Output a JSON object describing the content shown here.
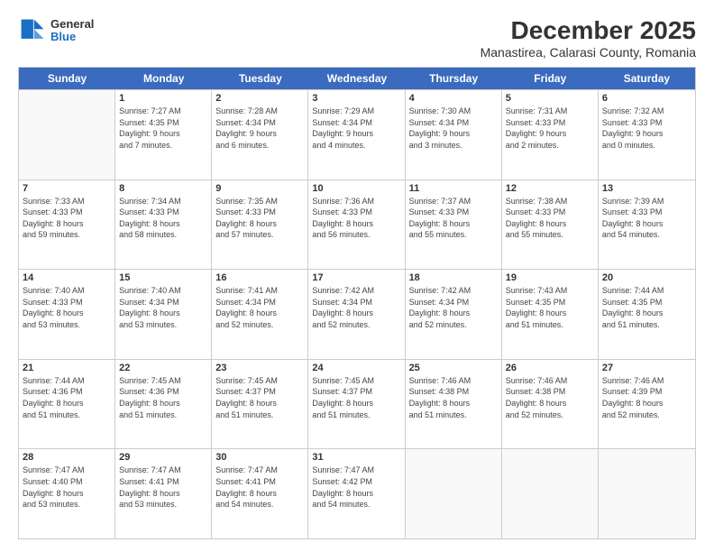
{
  "header": {
    "logo_general": "General",
    "logo_blue": "Blue",
    "title": "December 2025",
    "subtitle": "Manastirea, Calarasi County, Romania"
  },
  "calendar": {
    "days": [
      "Sunday",
      "Monday",
      "Tuesday",
      "Wednesday",
      "Thursday",
      "Friday",
      "Saturday"
    ],
    "rows": [
      [
        {
          "day": "",
          "content": ""
        },
        {
          "day": "1",
          "content": "Sunrise: 7:27 AM\nSunset: 4:35 PM\nDaylight: 9 hours\nand 7 minutes."
        },
        {
          "day": "2",
          "content": "Sunrise: 7:28 AM\nSunset: 4:34 PM\nDaylight: 9 hours\nand 6 minutes."
        },
        {
          "day": "3",
          "content": "Sunrise: 7:29 AM\nSunset: 4:34 PM\nDaylight: 9 hours\nand 4 minutes."
        },
        {
          "day": "4",
          "content": "Sunrise: 7:30 AM\nSunset: 4:34 PM\nDaylight: 9 hours\nand 3 minutes."
        },
        {
          "day": "5",
          "content": "Sunrise: 7:31 AM\nSunset: 4:33 PM\nDaylight: 9 hours\nand 2 minutes."
        },
        {
          "day": "6",
          "content": "Sunrise: 7:32 AM\nSunset: 4:33 PM\nDaylight: 9 hours\nand 0 minutes."
        }
      ],
      [
        {
          "day": "7",
          "content": "Sunrise: 7:33 AM\nSunset: 4:33 PM\nDaylight: 8 hours\nand 59 minutes."
        },
        {
          "day": "8",
          "content": "Sunrise: 7:34 AM\nSunset: 4:33 PM\nDaylight: 8 hours\nand 58 minutes."
        },
        {
          "day": "9",
          "content": "Sunrise: 7:35 AM\nSunset: 4:33 PM\nDaylight: 8 hours\nand 57 minutes."
        },
        {
          "day": "10",
          "content": "Sunrise: 7:36 AM\nSunset: 4:33 PM\nDaylight: 8 hours\nand 56 minutes."
        },
        {
          "day": "11",
          "content": "Sunrise: 7:37 AM\nSunset: 4:33 PM\nDaylight: 8 hours\nand 55 minutes."
        },
        {
          "day": "12",
          "content": "Sunrise: 7:38 AM\nSunset: 4:33 PM\nDaylight: 8 hours\nand 55 minutes."
        },
        {
          "day": "13",
          "content": "Sunrise: 7:39 AM\nSunset: 4:33 PM\nDaylight: 8 hours\nand 54 minutes."
        }
      ],
      [
        {
          "day": "14",
          "content": "Sunrise: 7:40 AM\nSunset: 4:33 PM\nDaylight: 8 hours\nand 53 minutes."
        },
        {
          "day": "15",
          "content": "Sunrise: 7:40 AM\nSunset: 4:34 PM\nDaylight: 8 hours\nand 53 minutes."
        },
        {
          "day": "16",
          "content": "Sunrise: 7:41 AM\nSunset: 4:34 PM\nDaylight: 8 hours\nand 52 minutes."
        },
        {
          "day": "17",
          "content": "Sunrise: 7:42 AM\nSunset: 4:34 PM\nDaylight: 8 hours\nand 52 minutes."
        },
        {
          "day": "18",
          "content": "Sunrise: 7:42 AM\nSunset: 4:34 PM\nDaylight: 8 hours\nand 52 minutes."
        },
        {
          "day": "19",
          "content": "Sunrise: 7:43 AM\nSunset: 4:35 PM\nDaylight: 8 hours\nand 51 minutes."
        },
        {
          "day": "20",
          "content": "Sunrise: 7:44 AM\nSunset: 4:35 PM\nDaylight: 8 hours\nand 51 minutes."
        }
      ],
      [
        {
          "day": "21",
          "content": "Sunrise: 7:44 AM\nSunset: 4:36 PM\nDaylight: 8 hours\nand 51 minutes."
        },
        {
          "day": "22",
          "content": "Sunrise: 7:45 AM\nSunset: 4:36 PM\nDaylight: 8 hours\nand 51 minutes."
        },
        {
          "day": "23",
          "content": "Sunrise: 7:45 AM\nSunset: 4:37 PM\nDaylight: 8 hours\nand 51 minutes."
        },
        {
          "day": "24",
          "content": "Sunrise: 7:45 AM\nSunset: 4:37 PM\nDaylight: 8 hours\nand 51 minutes."
        },
        {
          "day": "25",
          "content": "Sunrise: 7:46 AM\nSunset: 4:38 PM\nDaylight: 8 hours\nand 51 minutes."
        },
        {
          "day": "26",
          "content": "Sunrise: 7:46 AM\nSunset: 4:38 PM\nDaylight: 8 hours\nand 52 minutes."
        },
        {
          "day": "27",
          "content": "Sunrise: 7:46 AM\nSunset: 4:39 PM\nDaylight: 8 hours\nand 52 minutes."
        }
      ],
      [
        {
          "day": "28",
          "content": "Sunrise: 7:47 AM\nSunset: 4:40 PM\nDaylight: 8 hours\nand 53 minutes."
        },
        {
          "day": "29",
          "content": "Sunrise: 7:47 AM\nSunset: 4:41 PM\nDaylight: 8 hours\nand 53 minutes."
        },
        {
          "day": "30",
          "content": "Sunrise: 7:47 AM\nSunset: 4:41 PM\nDaylight: 8 hours\nand 54 minutes."
        },
        {
          "day": "31",
          "content": "Sunrise: 7:47 AM\nSunset: 4:42 PM\nDaylight: 8 hours\nand 54 minutes."
        },
        {
          "day": "",
          "content": ""
        },
        {
          "day": "",
          "content": ""
        },
        {
          "day": "",
          "content": ""
        }
      ]
    ]
  }
}
